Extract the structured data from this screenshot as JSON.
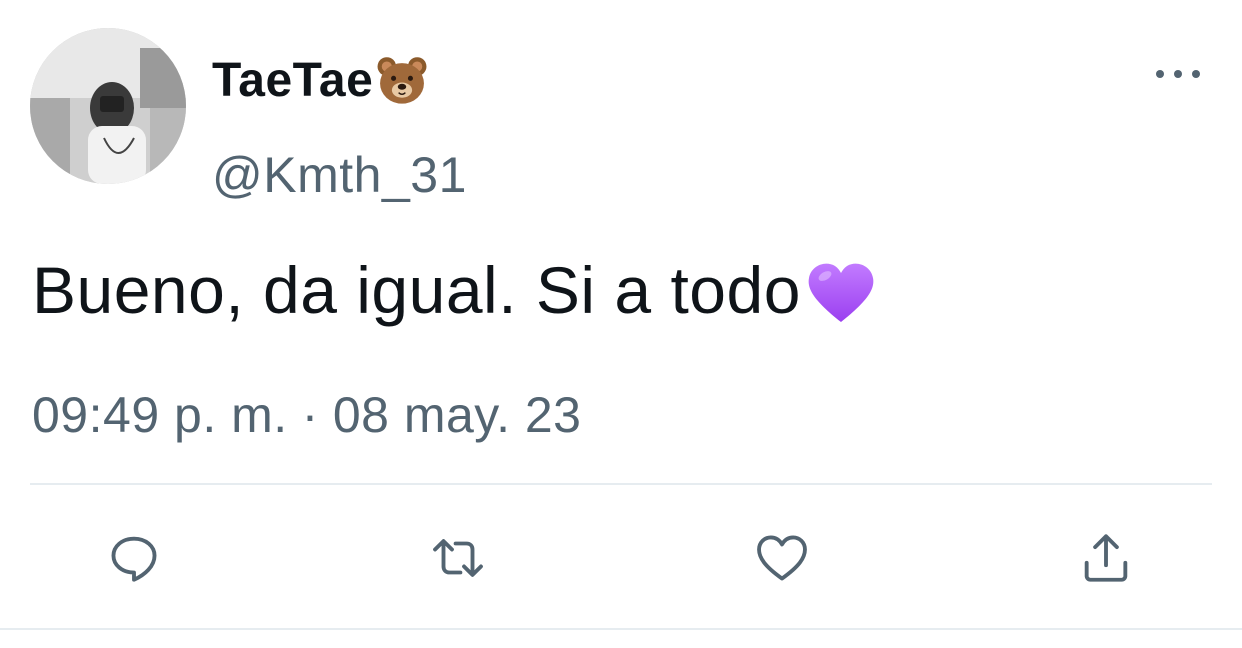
{
  "tweet": {
    "author": {
      "display_name": "TaeTae",
      "name_emoji": "bear-face-emoji",
      "handle": "@Kmth_31",
      "avatar": "profile-photo"
    },
    "text": "Bueno, da igual. Si a todo",
    "text_emoji": "purple-heart-emoji",
    "time": "09:49 p. m.",
    "separator": "·",
    "date": "08 may. 23"
  },
  "actions": [
    {
      "icon": "reply-icon"
    },
    {
      "icon": "retweet-icon"
    },
    {
      "icon": "like-icon"
    },
    {
      "icon": "share-icon"
    }
  ],
  "colors": {
    "text_primary": "#0f1419",
    "text_secondary": "#536471",
    "divider": "#e6ecf0",
    "purple_heart": "#a855f7"
  }
}
